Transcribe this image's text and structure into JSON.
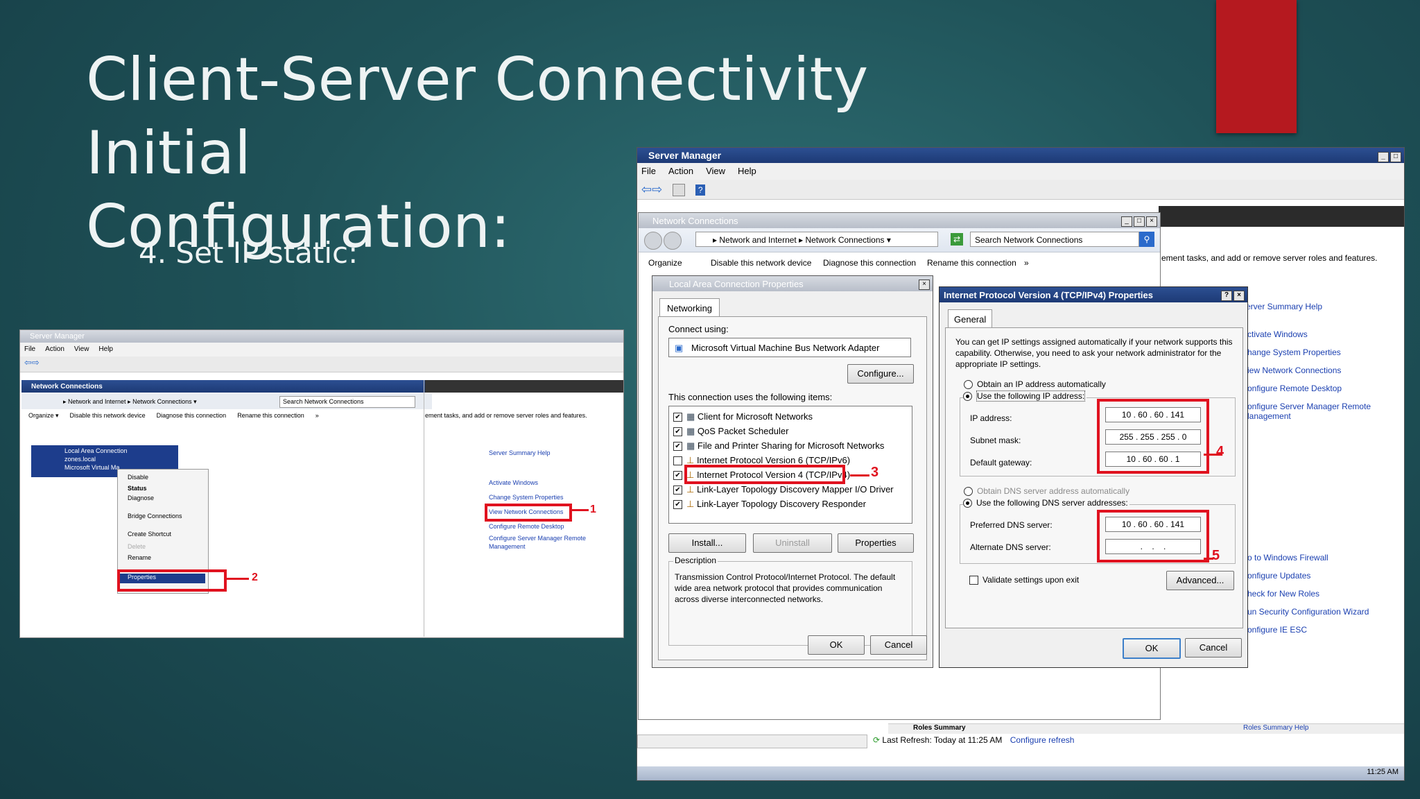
{
  "slide": {
    "title_line1": "Client-Server Connectivity Initial",
    "title_line2": "Configuration:",
    "bullet": "4. Set IP static:"
  },
  "small_screenshot": {
    "title": "Server Manager",
    "menu": [
      "File",
      "Action",
      "View",
      "Help"
    ],
    "nc_title": "Network Connections",
    "address": "▸ Network and Internet ▸ Network Connections ▾",
    "search": "Search Network Connections",
    "toolbar": [
      "Organize ▾",
      "Disable this network device",
      "Diagnose this connection",
      "Rename this connection",
      "»"
    ],
    "conn_name": "Local Area Connection",
    "conn_domain": "zones.local",
    "conn_adapter": "Microsoft Virtual Ma",
    "context_menu": [
      "Disable",
      "Status",
      "Diagnose",
      "Bridge Connections",
      "Create Shortcut",
      "Delete",
      "Rename",
      "Properties"
    ],
    "right_text": "ement tasks, and add or remove server roles and features.",
    "help": "Server Summary Help",
    "links": [
      "Activate Windows",
      "Change System Properties",
      "View Network Connections",
      "Configure Remote Desktop",
      "Configure Server Manager Remote Management"
    ],
    "callout1": "1",
    "callout2": "2"
  },
  "server_manager": {
    "title": "Server Manager",
    "menu": [
      "File",
      "Action",
      "View",
      "Help"
    ],
    "right_text": "ement tasks, and add or remove server roles and features.",
    "help": "erver Summary Help",
    "links": [
      "ctivate Windows",
      "hange System Properties",
      "iew Network Connections",
      "onfigure Remote Desktop",
      "onfigure Server Manager Remote",
      "lanagement"
    ],
    "links2": [
      "o to Windows Firewall",
      "onfigure Updates",
      "heck for New Roles",
      "un Security Configuration Wizard",
      "onfigure IE ESC"
    ],
    "roles_summary": "Roles Summary",
    "roles_summary_help": "Roles Summary Help",
    "last_refresh": "Last Refresh: Today at 11:25 AM",
    "configure_refresh": "Configure refresh",
    "clock": "11:25 AM"
  },
  "network_connections": {
    "title": "Network Connections",
    "address_part1": "Network and Internet",
    "address_part2": "Network Connections",
    "search_placeholder": "Search Network Connections",
    "toolbar": [
      "Organize",
      "Disable this network device",
      "Diagnose this connection",
      "Rename this connection",
      "»"
    ]
  },
  "lac_properties": {
    "title": "Local Area Connection Properties",
    "tab": "Networking",
    "connect_using_label": "Connect using:",
    "adapter": "Microsoft Virtual Machine Bus Network Adapter",
    "configure_btn": "Configure...",
    "items_label": "This connection uses the following items:",
    "items": [
      {
        "label": "Client for Microsoft Networks",
        "checked": true
      },
      {
        "label": "QoS Packet Scheduler",
        "checked": true
      },
      {
        "label": "File and Printer Sharing for Microsoft Networks",
        "checked": true
      },
      {
        "label": "Internet Protocol Version 6 (TCP/IPv6)",
        "checked": false
      },
      {
        "label": "Internet Protocol Version 4 (TCP/IPv4)",
        "checked": true
      },
      {
        "label": "Link-Layer Topology Discovery Mapper I/O Driver",
        "checked": true
      },
      {
        "label": "Link-Layer Topology Discovery Responder",
        "checked": true
      }
    ],
    "install_btn": "Install...",
    "uninstall_btn": "Uninstall",
    "properties_btn": "Properties",
    "description_label": "Description",
    "description": "Transmission Control Protocol/Internet Protocol. The default wide area network protocol that provides communication across diverse interconnected networks.",
    "ok": "OK",
    "cancel": "Cancel",
    "callout3": "3"
  },
  "ipv4_properties": {
    "title": "Internet Protocol Version 4 (TCP/IPv4) Properties",
    "tab": "General",
    "intro": "You can get IP settings assigned automatically if your network supports this capability. Otherwise, you need to ask your network administrator for the appropriate IP settings.",
    "obtain_auto": "Obtain an IP address automatically",
    "use_following": "Use the following IP address:",
    "ip_label": "IP address:",
    "ip": [
      "10",
      "60",
      "60",
      "141"
    ],
    "subnet_label": "Subnet mask:",
    "subnet": [
      "255",
      "255",
      "255",
      "0"
    ],
    "gateway_label": "Default gateway:",
    "gateway": [
      "10",
      "60",
      "60",
      "1"
    ],
    "dns_auto": "Obtain DNS server address automatically",
    "dns_use": "Use the following DNS server addresses:",
    "preferred_label": "Preferred DNS server:",
    "preferred": [
      "10",
      "60",
      "60",
      "141"
    ],
    "alternate_label": "Alternate DNS server:",
    "validate": "Validate settings upon exit",
    "advanced_btn": "Advanced...",
    "ok": "OK",
    "cancel": "Cancel",
    "callout4": "4",
    "callout5": "5"
  }
}
